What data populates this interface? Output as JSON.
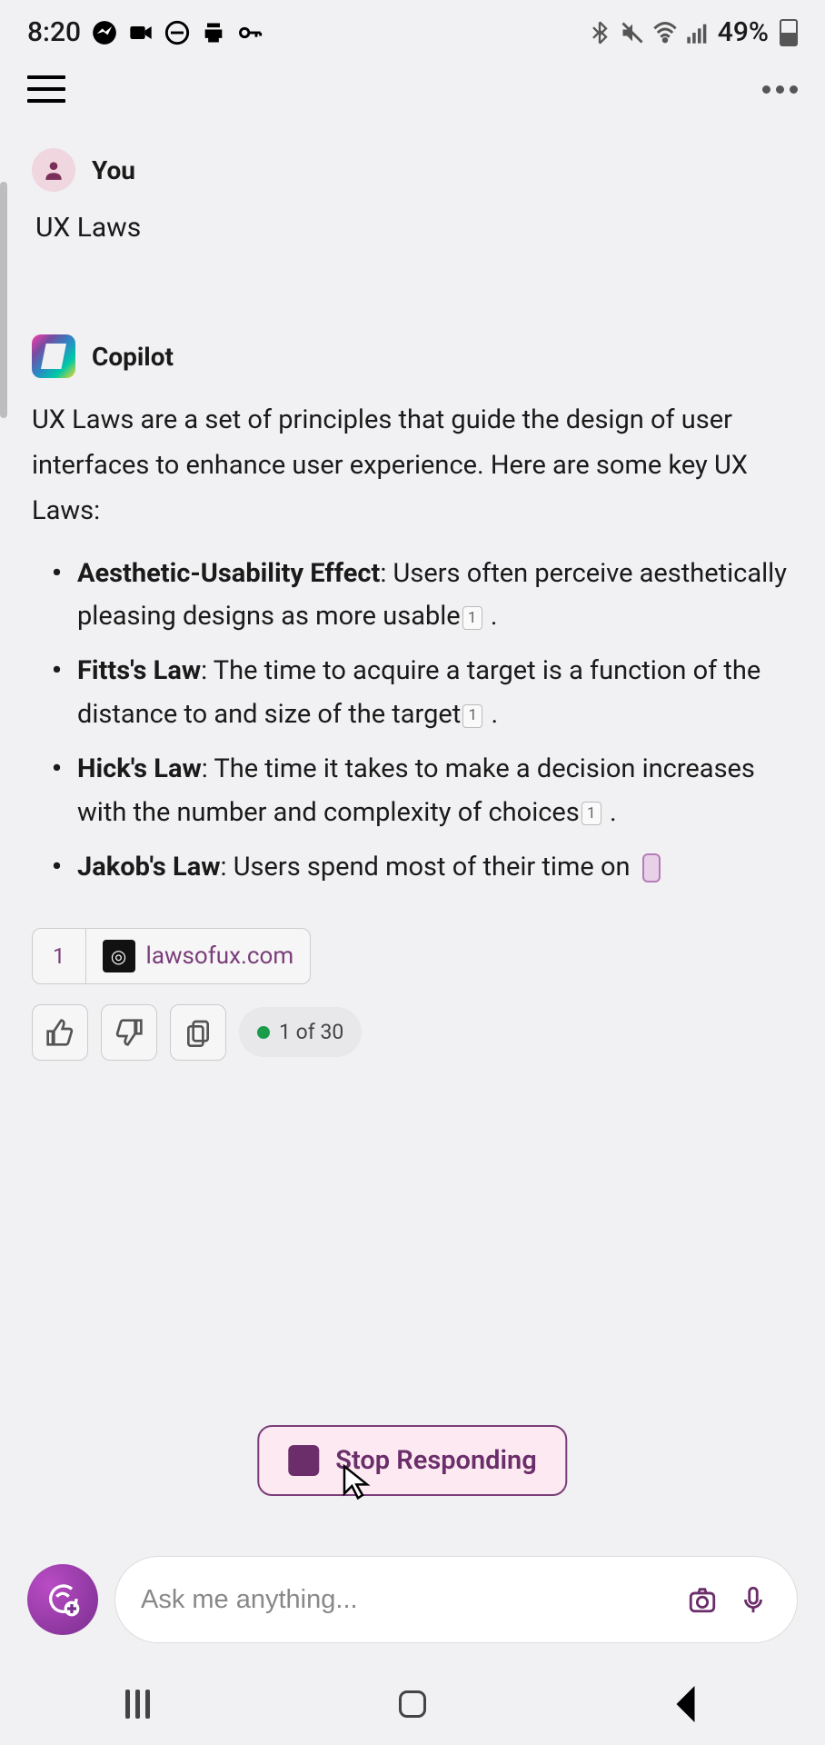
{
  "status": {
    "time": "8:20",
    "battery": "49%"
  },
  "user": {
    "sender": "You",
    "message": "UX Laws"
  },
  "assistant": {
    "sender": "Copilot",
    "intro": "UX Laws are a set of principles that guide the design of user interfaces to enhance user experience. Here are some key UX Laws:",
    "laws": [
      {
        "title": "Aesthetic-Usability Effect",
        "desc": ": Users often perceive aesthetically pleasing designs as more usable",
        "cite": "1",
        "trail": " ."
      },
      {
        "title": "Fitts's Law",
        "desc": ": The time to acquire a target is a function of the distance to and size of the target",
        "cite": "1",
        "trail": " ."
      },
      {
        "title": "Hick's Law",
        "desc": ": The time it takes to make a decision increases with the number and complexity of choices",
        "cite": "1",
        "trail": " ."
      },
      {
        "title": "Jakob's Law",
        "desc": ": Users spend most of their time on ",
        "cite": "",
        "trail": ""
      }
    ],
    "source": {
      "num": "1",
      "url": "lawsofux.com"
    },
    "counter": "1 of 30"
  },
  "stop": {
    "label": "Stop Responding"
  },
  "input": {
    "placeholder": "Ask me anything..."
  }
}
